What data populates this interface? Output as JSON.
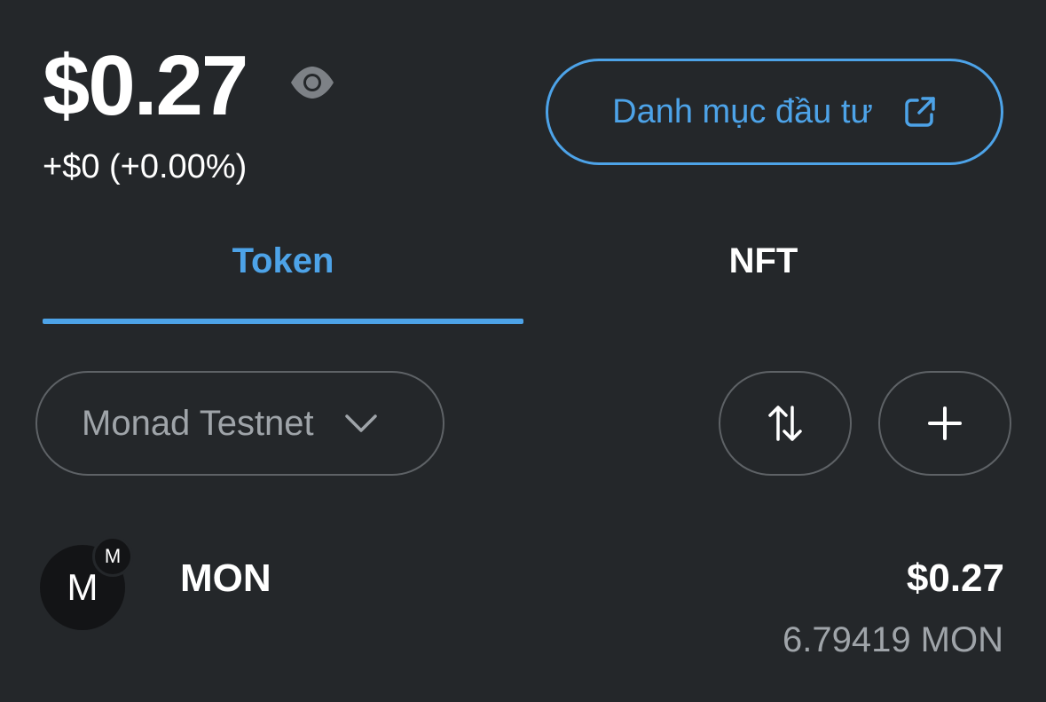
{
  "header": {
    "balance": "$0.27",
    "change": "+$0 (+0.00%)",
    "visibility_icon": "eye-icon",
    "portfolio_label": "Danh mục đầu tư",
    "portfolio_icon": "external-link-icon"
  },
  "tabs": [
    {
      "label": "Token",
      "active": true
    },
    {
      "label": "NFT",
      "active": false
    }
  ],
  "controls": {
    "network_label": "Monad Testnet",
    "network_icon": "chevron-down-icon",
    "sort_icon": "sort-arrows-icon",
    "add_icon": "plus-icon"
  },
  "tokens": [
    {
      "avatar_letter": "M",
      "badge_letter": "M",
      "symbol": "MON",
      "fiat_value": "$0.27",
      "amount": "6.79419 MON"
    }
  ],
  "colors": {
    "background": "#24272a",
    "accent": "#4da3e8",
    "muted": "#9fa4a9",
    "border": "#5e6266"
  }
}
